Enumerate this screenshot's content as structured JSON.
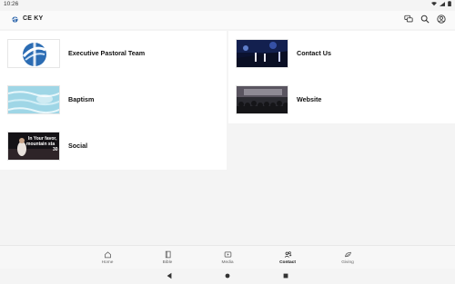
{
  "status": {
    "time": "10:26"
  },
  "app": {
    "title": "CE KY"
  },
  "cards": [
    {
      "label": "Executive Pastoral Team",
      "thumb": "logo"
    },
    {
      "label": "Contact Us",
      "thumb": "stage-blue"
    },
    {
      "label": "Baptism",
      "thumb": "water"
    },
    {
      "label": "Website",
      "thumb": "crowd"
    },
    {
      "label": "Social",
      "thumb": "worship-text",
      "thumb_text": [
        "In Your favor,",
        "mountain sta",
        "30"
      ]
    }
  ],
  "nav": [
    {
      "label": "Home",
      "icon": "home-icon"
    },
    {
      "label": "Bible",
      "icon": "book-icon"
    },
    {
      "label": "Media",
      "icon": "play-icon"
    },
    {
      "label": "Contact",
      "icon": "people-icon",
      "active": true
    },
    {
      "label": "Giving",
      "icon": "leaf-icon"
    }
  ]
}
